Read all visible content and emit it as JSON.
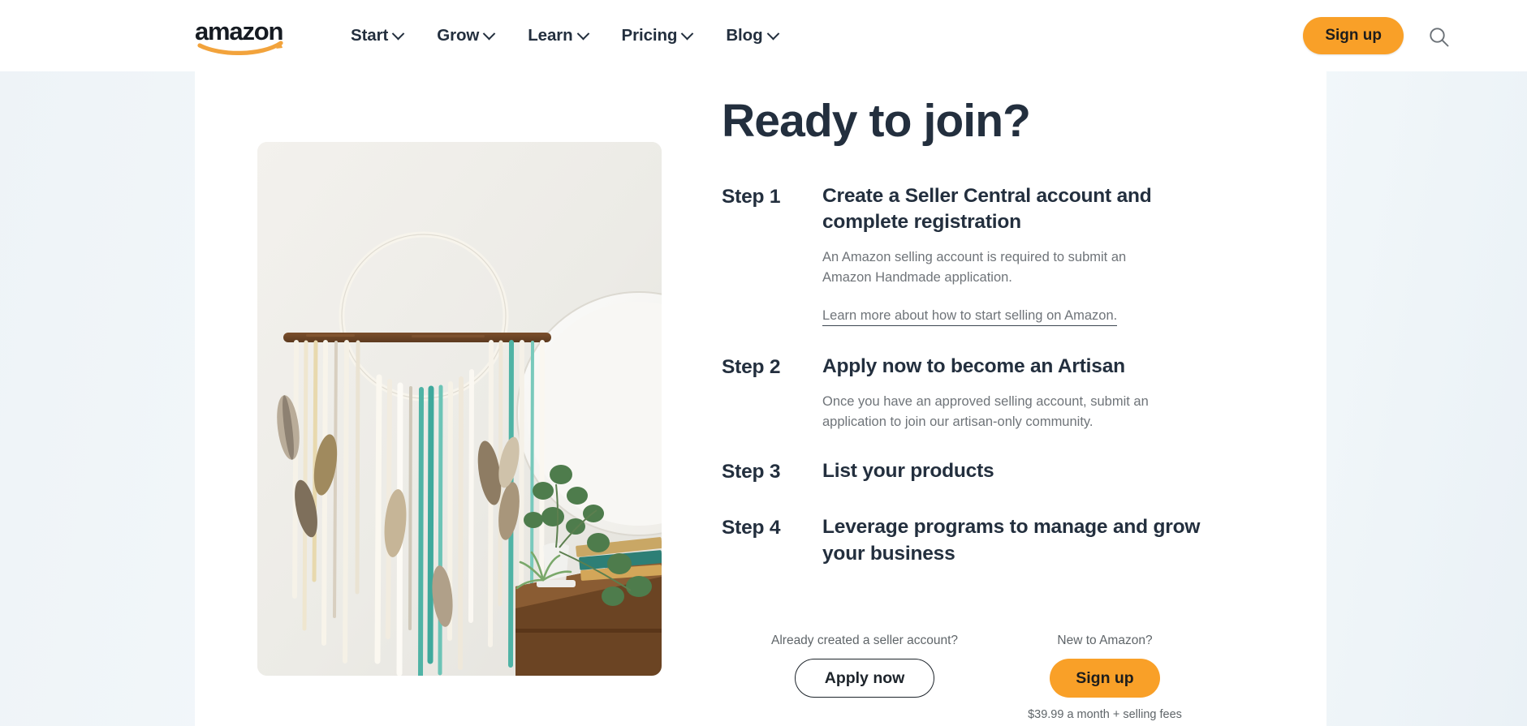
{
  "header": {
    "logo_alt": "amazon",
    "nav": [
      {
        "label": "Start",
        "icon": "chevron-down-icon"
      },
      {
        "label": "Grow",
        "icon": "chevron-down-icon"
      },
      {
        "label": "Learn",
        "icon": "chevron-down-icon"
      },
      {
        "label": "Pricing",
        "icon": "chevron-down-icon"
      },
      {
        "label": "Blog",
        "icon": "chevron-down-icon"
      }
    ],
    "signup_label": "Sign up",
    "search_icon": "search-icon"
  },
  "main": {
    "title": "Ready to join?",
    "steps": [
      {
        "label": "Step 1",
        "heading": "Create a Seller Central account and complete registration",
        "description": "An Amazon selling account is required to submit an Amazon Handmade application.",
        "link": "Learn more about how to start selling on Amazon."
      },
      {
        "label": "Step 2",
        "heading": "Apply now to become an Artisan",
        "description": "Once you have an approved selling account, submit an application to join our artisan-only community."
      },
      {
        "label": "Step 3",
        "heading": "List your products"
      },
      {
        "label": "Step 4",
        "heading": "Leverage programs to manage and grow your business"
      }
    ],
    "photo_alt": "Handmade macrame dreamcatcher wall hanging with feathers above a wooden dresser with books and plants"
  },
  "cta": {
    "existing_caption": "Already created a seller account?",
    "apply_label": "Apply now",
    "new_caption": "New to Amazon?",
    "signup_label": "Sign up",
    "price_note": "$39.99 a month + selling fees"
  },
  "colors": {
    "brand_orange": "#f9a028",
    "ink": "#232f3e",
    "muted": "#6f7479",
    "page_bg": "#eef3f7",
    "card_bg": "#ffffff"
  }
}
